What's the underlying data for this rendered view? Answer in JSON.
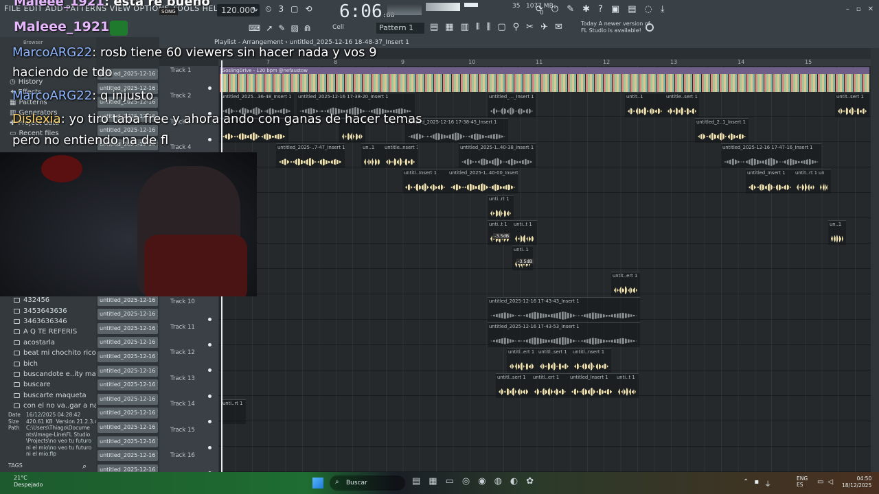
{
  "menu": [
    "FILE",
    "EDIT",
    "ADD",
    "PATTERNS",
    "VIEW",
    "OPTIONS",
    "TOOLS",
    "HELP"
  ],
  "tempo": "120.000",
  "song_mode": "SONG",
  "time": {
    "main": "6:06",
    "sub": ":00"
  },
  "memory": {
    "cpu": "35",
    "mem": "1077 MB",
    "poly": "0"
  },
  "pattern": "Pattern 1",
  "snap": "Cell",
  "new_version": {
    "line1": "Today  A newer version of",
    "line2": "FL Studio is available!"
  },
  "overlay_top": {
    "user": "Maleee_1921",
    "text": ": esta re bueno"
  },
  "overlay_second": {
    "user": "Maleee_1921",
    "text": ":"
  },
  "playlist": {
    "title": "Playlist - Arrangement",
    "path": "untitled_2025-12-16 18-48-37_Insert 1",
    "browser": "Browser"
  },
  "ruler": [
    "7",
    "8",
    "9",
    "10",
    "11",
    "12",
    "13",
    "14",
    "15"
  ],
  "chat": [
    {
      "user": "MarcoARG22",
      "text": ": rosb tiene 60 viewers sin hacer nada y vos 9"
    },
    {
      "user": "",
      "text": "haciendo de tdo"
    },
    {
      "user": "MarcoARG22",
      "text": ": q injusto"
    },
    {
      "user": "Dislexia",
      "text": ": yo tiro taba free y ahora ando con ganas de hacer temas"
    },
    {
      "user": "",
      "text": "pero no entiendo na de fl"
    }
  ],
  "browser_items": [
    "History",
    "Effects",
    "Patterns",
    "Generators",
    "Project data",
    "Recent files"
  ],
  "folders": [
    "432456",
    "3453643636",
    "3463636346",
    "A Q TE REFERIS",
    "acostarla",
    "beat mi chochito rico",
    "bich",
    "buscandote e..ity maqueta",
    "buscare",
    "buscarte maqueta",
    "con el no va..gar a nada ft"
  ],
  "file_info": {
    "date_label": "Date",
    "date": "16/12/2025 04:28:42",
    "size_label": "Size",
    "size": "420.61 KB",
    "version_label": "Version",
    "version": "21.2.3.40",
    "path_label": "Path",
    "path": "C:\\Users\\Thiago\\Documents\\Image-Line\\FL Studio\\Projects\\no veo tu futuro ni el mio\\no veo tu futuro ni el mio.flp",
    "tags": "TAGS"
  },
  "track_buttons": [
    "untitled_2025-12-16 18-",
    "untitled_2025-12-16 18-",
    "untitled_2025-12-16 18-",
    "untitled_2025-12-16 18-",
    "untitled_2025-12-16 18-",
    "untitled_2025-12-16 18-",
    "untitled_2025-12-16 18-",
    "untitled_2025-12-16 18-",
    "untitled_2025-12-16 18-",
    "untitled_2025-12-16 18-",
    "untitled_2025-12-16 18-",
    "untitled_2025-12-16 18-",
    "untitled_2025-12-16 18-",
    "untitled_2025-12-16 18-",
    "untitled_2025-12-16 18-",
    "untitled_2025-12-16 18-",
    "untitled_2025-12-16 18-",
    "untitled_2025-12-16 18-",
    "untitled_2025-12-16 18-",
    "untitled_2025-12-16 18-",
    "untitled_2025-12-16 18-",
    "untitled_2025-12-16 18-",
    "untitled_2025-12-16 18-",
    "untitled_2025-12-16 18-",
    "untitled_2025-12-16 18-",
    "untitled_2025-12-16 18-",
    "untitled_2025-12-16 18-",
    "untitled_2025-12-16 18-",
    "untitled_2025-12-16 18-",
    "untitled_2025-12-16 18-"
  ],
  "tracks": [
    "Track 1",
    "Track 2",
    "Track 3",
    "Track 4",
    "Track 5",
    "Track 6",
    "Track 7",
    "Track 8",
    "Track 9",
    "Track 10",
    "Track 11",
    "Track 12",
    "Track 13",
    "Track 14",
    "Track 15",
    "Track 16"
  ],
  "main_clip": "GoslingDrive - 120 bpm @nefaustow",
  "clips": {
    "c1": "untitled_2025...36-48_Insert 1",
    "c2": "untitled_2025-12-16 17-38-20_Insert 1",
    "c3": "untitled_..._Insert 1",
    "c4": "untit..1",
    "c5": "untitle..sert 1",
    "c6": "untit..sert 1",
    "c7": "untitled_2..1_Insert 1",
    "c8": "untitled_2025-12-16 17-38-45_Insert 1",
    "c9": "untitled_2025-..7-47_Insert 1",
    "c10": "un..1",
    "c11": "untitle..nsert 1",
    "c12": "untitled_2025-1..40-38_Insert 1",
    "c13": "untitled_2025-12-16 17-47-16_Insert 1",
    "c14": "untitl..Insert 1",
    "c15": "untitled_2025-1..40-00_Insert 1",
    "c16": "untitled_Insert 1",
    "c17": "untit..rt 1",
    "c18": "un",
    "c19": "unti..rt 1",
    "c20": "unti..t 1",
    "c21": "unti..t 1",
    "c22": "un..1",
    "c23": "unti..1",
    "c24": "untit..ert 1",
    "c25": "untitled_2025-12-16 17-43-43_Insert 1",
    "c26": "untitled_2025-12-16 17-43-53_Insert 1",
    "c27": "untitl..ert 1",
    "c28": "untitl..sert 1",
    "c29": "untitl..nsert 1",
    "c30": "untitl..sert 1",
    "c31": "untitl..ert 1",
    "c32": "untitled_Insert 1",
    "c33": "unti..t 1",
    "c34": "unti..rt 1"
  },
  "vol_labels": {
    "v1": "-3.5dB",
    "v2": "-3.5dB"
  },
  "taskbar": {
    "temp": "21°C",
    "weather": "Despejado",
    "search": "Buscar",
    "lang": "ENG",
    "region": "ES",
    "time": "04:50",
    "date": "18/12/2025"
  }
}
